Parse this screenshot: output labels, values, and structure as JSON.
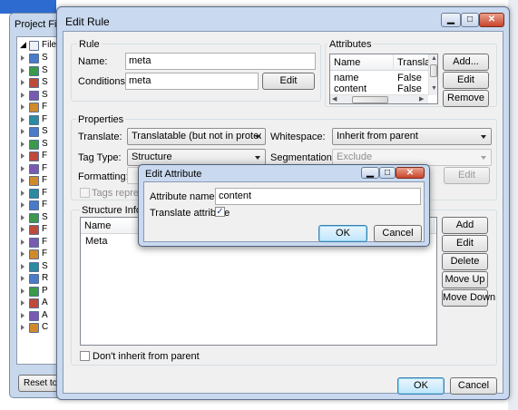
{
  "background_window": {
    "title": "Project File Ty",
    "tree_root_label": "File",
    "tree_items": [
      "S",
      "S",
      "S",
      "S",
      "F",
      "F",
      "S",
      "S",
      "F",
      "F",
      "F",
      "F",
      "F",
      "S",
      "F",
      "F",
      "F",
      "S",
      "R",
      "P",
      "A",
      "A",
      "C"
    ],
    "reset_button": "Reset to De"
  },
  "edit_rule": {
    "title": "Edit Rule",
    "rule_group": {
      "caption": "Rule",
      "name_label": "Name:",
      "name_value": "meta",
      "conditions_label": "Conditions:",
      "conditions_value": "meta",
      "edit_button": "Edit"
    },
    "attributes": {
      "caption": "Attributes",
      "columns": [
        "Name",
        "Translate"
      ],
      "rows": [
        {
          "name": "name",
          "translate": "False"
        },
        {
          "name": "content",
          "translate": "False"
        }
      ],
      "buttons": {
        "add": "Add...",
        "edit": "Edit",
        "remove": "Remove"
      }
    },
    "properties": {
      "caption": "Properties",
      "translate_label": "Translate:",
      "translate_value": "Translatable (but not in protected content",
      "whitespace_label": "Whitespace:",
      "whitespace_value": "Inherit from parent",
      "tag_type_label": "Tag Type:",
      "tag_type_value": "Structure",
      "segmentation_label": "Segmentation hint:",
      "segmentation_value": "Exclude",
      "formatting_label": "Formatting:",
      "formatting_edit": "Edit",
      "tags_represent": "Tags represent f"
    },
    "structure": {
      "caption": "Structure Informatio",
      "column": "Name",
      "rows": [
        "Meta"
      ],
      "buttons": {
        "add": "Add",
        "edit": "Edit",
        "delete": "Delete",
        "move_up": "Move Up",
        "move_down": "Move Down"
      },
      "dont_inherit": "Don't inherit from parent"
    },
    "ok": "OK",
    "cancel": "Cancel"
  },
  "edit_attribute": {
    "title": "Edit Attribute",
    "attribute_name_label": "Attribute name:",
    "attribute_name_value": "content",
    "translate_label": "Translate attribute",
    "translate_checked": true,
    "checkmark": "✓",
    "ok": "OK",
    "cancel": "Cancel"
  },
  "caption_glyphs": {
    "minimize": "▁",
    "maximize": "□",
    "close": "✕"
  },
  "colors": {
    "titlebar": "#c9d9ef",
    "client": "#f0f0f0",
    "close_button": "#c8452c",
    "desktop_blue": "#2e6bd0"
  }
}
